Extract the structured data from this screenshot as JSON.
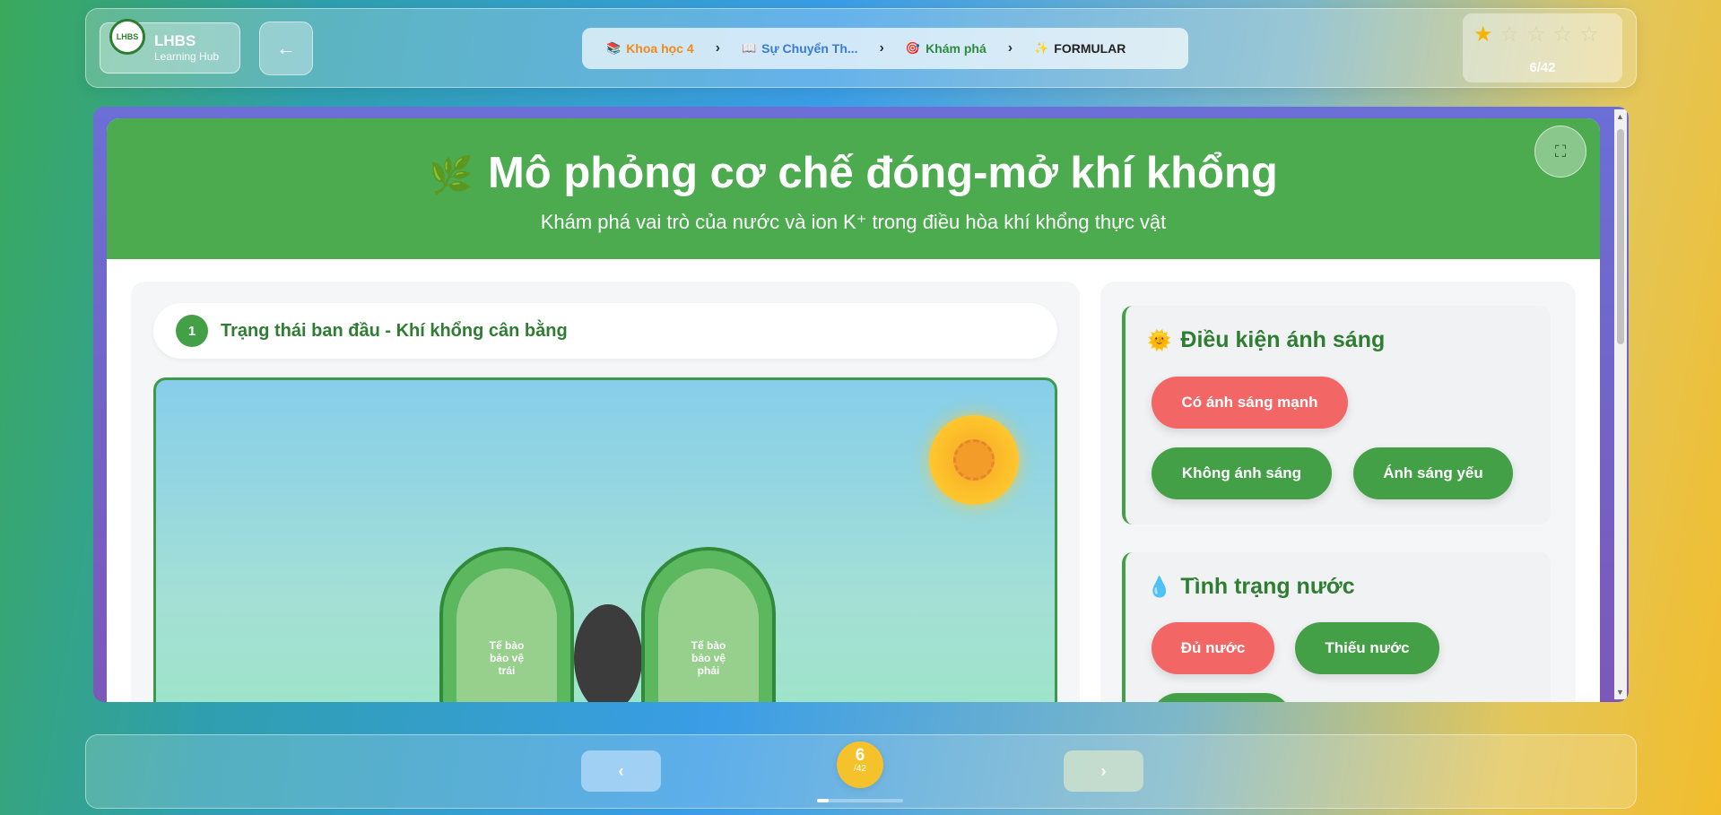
{
  "header": {
    "logo_title": "LHBS",
    "logo_sub": "Learning Hub",
    "logo_badge": "LHBS",
    "breadcrumb": [
      {
        "icon": "📚",
        "label": "Khoa học 4"
      },
      {
        "icon": "📖",
        "label": "Sự Chuyển Th..."
      },
      {
        "icon": "🎯",
        "label": "Khám phá"
      },
      {
        "icon": "✨",
        "label": "FORMULAR"
      }
    ],
    "separator": "›",
    "stars": {
      "filled": 1,
      "total": 5
    },
    "score": "6/42"
  },
  "card": {
    "title_icon": "🌿",
    "title": "Mô phỏng cơ chế đóng-mở khí khổng",
    "subtitle": "Khám phá vai trò của nước và ion K⁺ trong điều hòa khí khổng thực vật",
    "fullscreen_icon": "⛶"
  },
  "simulation": {
    "step_number": "1",
    "step_label": "Trạng thái ban đầu - Khí khổng cân bằng",
    "guard_left": "Tế bào bảo vệ trái",
    "guard_right": "Tế bào bảo vệ phải"
  },
  "controls": {
    "light": {
      "icon": "🌞",
      "title": "Điều kiện ánh sáng",
      "options": [
        "Có ánh sáng mạnh",
        "Không ánh sáng",
        "Ánh sáng yếu"
      ],
      "active": "Có ánh sáng mạnh"
    },
    "water": {
      "icon": "💧",
      "title": "Tình trạng nước",
      "options": [
        "Đủ nước",
        "Thiếu nước"
      ],
      "active": "Đủ nước"
    }
  },
  "nav": {
    "prev": "‹",
    "next": "›",
    "back": "←",
    "page_current": "6",
    "page_total": "/42",
    "progress": 0.14
  },
  "colors": {
    "accent_green": "#43a047",
    "active_red": "#f26666",
    "page_badge": "#f5c22b"
  }
}
